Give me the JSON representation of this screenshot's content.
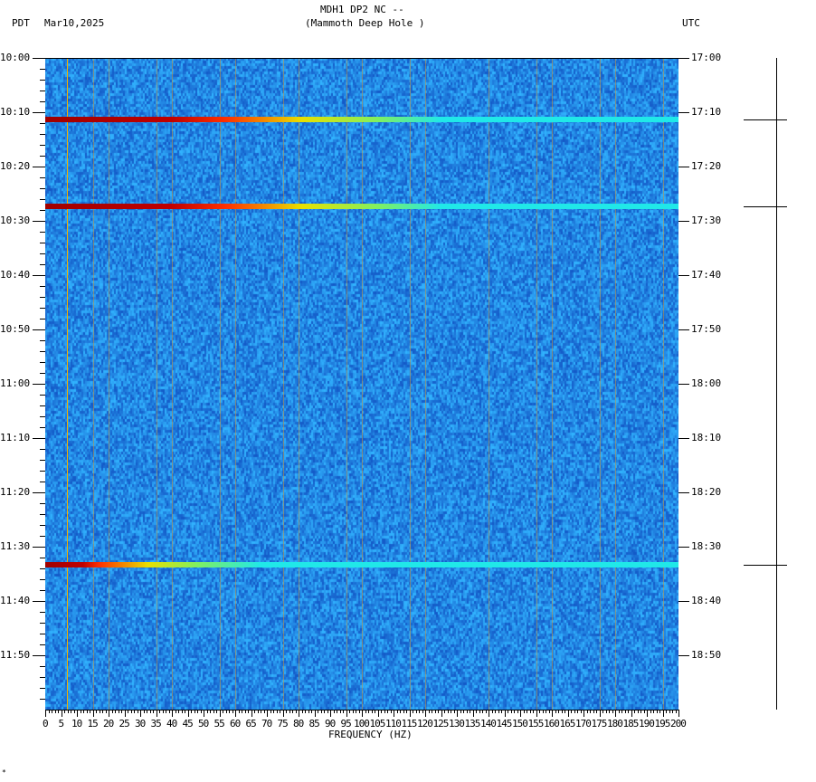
{
  "header": {
    "station": "MDH1 DP2 NC --",
    "site": "(Mammoth Deep Hole )",
    "left_tz": "PDT",
    "date": "Mar10,2025",
    "right_tz": "UTC"
  },
  "footer_mark": "*",
  "chart_data": {
    "type": "heatmap",
    "title": "MDH1 DP2 NC -- (Mammoth Deep Hole )",
    "xlabel": "FREQUENCY (HZ)",
    "xlim": [
      0,
      200
    ],
    "x_ticks": [
      "0",
      "5",
      "10",
      "15",
      "20",
      "25",
      "30",
      "35",
      "40",
      "45",
      "50",
      "55",
      "60",
      "65",
      "70",
      "75",
      "80",
      "85",
      "90",
      "95",
      "100",
      "105",
      "110",
      "115",
      "120",
      "125",
      "130",
      "135",
      "140",
      "145",
      "150",
      "155",
      "160",
      "165",
      "170",
      "175",
      "180",
      "185",
      "190",
      "195",
      "200"
    ],
    "y_left_ticks": [
      "10:00",
      "10:10",
      "10:20",
      "10:30",
      "10:40",
      "10:50",
      "11:00",
      "11:10",
      "11:20",
      "11:30",
      "11:40",
      "11:50"
    ],
    "y_right_ticks": [
      "17:00",
      "17:10",
      "17:20",
      "17:30",
      "17:40",
      "17:50",
      "18:00",
      "18:10",
      "18:20",
      "18:30",
      "18:40",
      "18:50"
    ],
    "time_range_minutes": 120,
    "background": "blue noise (low power)",
    "events": [
      {
        "minute": 11.3,
        "red_until_hz": 57,
        "yellow_until_hz": 105
      },
      {
        "minute": 27.3,
        "red_until_hz": 57,
        "yellow_until_hz": 105
      },
      {
        "minute": 93.3,
        "red_until_hz": 17,
        "yellow_until_hz": 48
      }
    ],
    "persistent_lines_hz": [
      6.9,
      15,
      20,
      35,
      40,
      55,
      60,
      75,
      80,
      95,
      100,
      115,
      120,
      140,
      155,
      160,
      175,
      180,
      195
    ],
    "colors": {
      "bg": "#1f6fe0",
      "red": "#a00000",
      "yellow": "#e8e000",
      "cyan": "#20e8e8",
      "line": "#e0a000"
    }
  }
}
